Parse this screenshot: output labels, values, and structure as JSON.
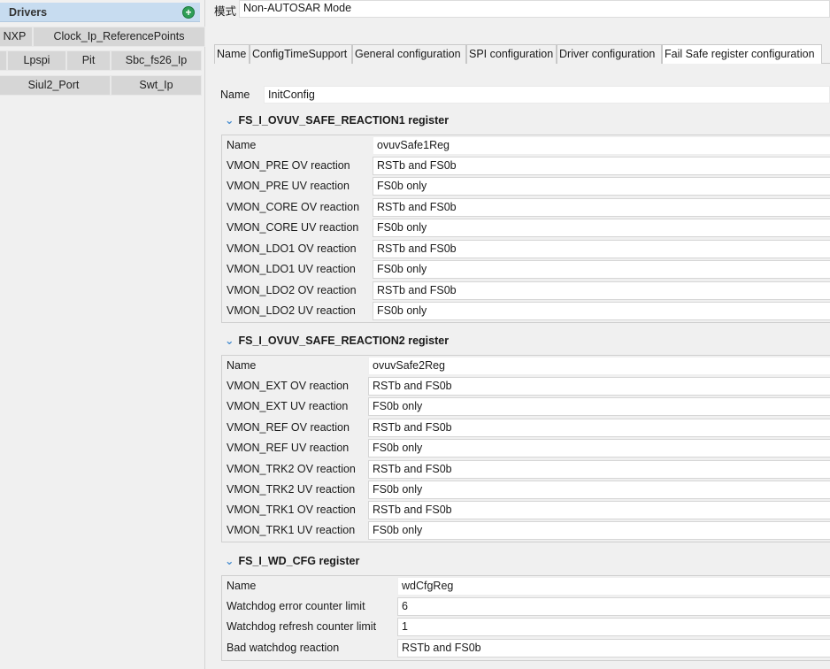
{
  "drivers_panel": {
    "title": "Drivers",
    "items": {
      "nxp": "NXP",
      "clock": "Clock_Ip_ReferencePoints",
      "lpspi": "Lpspi",
      "pit": "Pit",
      "sbc": "Sbc_fs26_Ip",
      "siul": "Siul2_Port",
      "swt": "Swt_Ip"
    }
  },
  "mode": {
    "label": "模式",
    "value": "Non-AUTOSAR Mode"
  },
  "tabs": [
    {
      "label": "Name"
    },
    {
      "label": "ConfigTimeSupport"
    },
    {
      "label": "General configuration"
    },
    {
      "label": "SPI configuration"
    },
    {
      "label": "Driver configuration"
    },
    {
      "label": "Fail Safe register configuration",
      "active": true
    }
  ],
  "config": {
    "name_label": "Name",
    "name_value": "InitConfig"
  },
  "sections": [
    {
      "title": "FS_I_OVUV_SAFE_REACTION1 register",
      "rows": [
        {
          "label": "Name",
          "value": "ovuvSafe1Reg"
        },
        {
          "label": "VMON_PRE OV reaction",
          "value": "RSTb and FS0b"
        },
        {
          "label": "VMON_PRE UV reaction",
          "value": "FS0b only"
        },
        {
          "label": "VMON_CORE OV reaction",
          "value": "RSTb and FS0b"
        },
        {
          "label": "VMON_CORE UV reaction",
          "value": "FS0b only"
        },
        {
          "label": "VMON_LDO1 OV reaction",
          "value": "RSTb and FS0b"
        },
        {
          "label": "VMON_LDO1 UV reaction",
          "value": "FS0b only"
        },
        {
          "label": "VMON_LDO2 OV reaction",
          "value": "RSTb and FS0b"
        },
        {
          "label": "VMON_LDO2 UV reaction",
          "value": "FS0b only"
        }
      ]
    },
    {
      "title": "FS_I_OVUV_SAFE_REACTION2 register",
      "rows": [
        {
          "label": "Name",
          "value": "ovuvSafe2Reg"
        },
        {
          "label": "VMON_EXT OV reaction",
          "value": "RSTb and FS0b"
        },
        {
          "label": "VMON_EXT UV reaction",
          "value": "FS0b only"
        },
        {
          "label": "VMON_REF OV reaction",
          "value": "RSTb and FS0b"
        },
        {
          "label": "VMON_REF UV reaction",
          "value": "FS0b only"
        },
        {
          "label": "VMON_TRK2 OV reaction",
          "value": "RSTb and FS0b"
        },
        {
          "label": "VMON_TRK2 UV reaction",
          "value": "FS0b only"
        },
        {
          "label": "VMON_TRK1 OV reaction",
          "value": "RSTb and FS0b"
        },
        {
          "label": "VMON_TRK1 UV reaction",
          "value": "FS0b only"
        }
      ]
    },
    {
      "title": "FS_I_WD_CFG register",
      "rows": [
        {
          "label": "Name",
          "value": "wdCfgReg"
        },
        {
          "label": "Watchdog error counter limit",
          "value": "6"
        },
        {
          "label": "Watchdog refresh counter limit",
          "value": "1"
        },
        {
          "label": "Bad watchdog reaction",
          "value": "RSTb and FS0b"
        }
      ]
    }
  ]
}
